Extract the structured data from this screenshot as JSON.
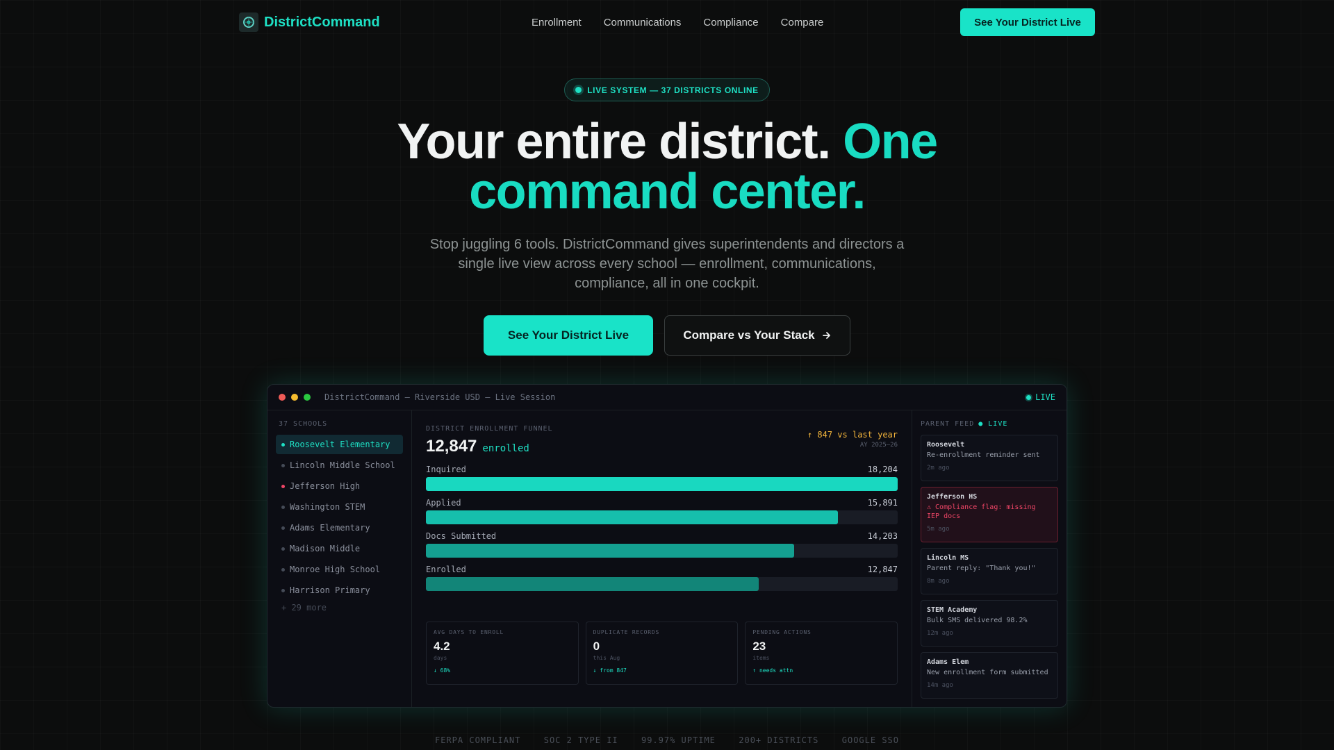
{
  "nav": {
    "brand": "DistrictCommand",
    "links": [
      "Enrollment",
      "Communications",
      "Compliance",
      "Compare"
    ],
    "cta_label": "See Your District Live"
  },
  "hero": {
    "badge": "LIVE SYSTEM — 37 DISTRICTS ONLINE",
    "headline_plain": "Your entire district.",
    "headline_accent": "One command center.",
    "subhead": "Stop juggling 6 tools. DistrictCommand gives superintendents and directors a single live view across every school — enrollment, communications, compliance, all in one cockpit.",
    "primary_cta": "See Your District Live",
    "secondary_cta": "Compare vs Your Stack"
  },
  "dashboard": {
    "window_title": "DistrictCommand — Riverside USD — Live Session",
    "live_label": "LIVE",
    "sidebar": {
      "heading": "37 SCHOOLS",
      "schools": [
        {
          "name": "Roosevelt Elementary",
          "state": "active"
        },
        {
          "name": "Lincoln Middle School",
          "state": "normal"
        },
        {
          "name": "Jefferson High",
          "state": "alert"
        },
        {
          "name": "Washington STEM",
          "state": "normal"
        },
        {
          "name": "Adams Elementary",
          "state": "normal"
        },
        {
          "name": "Madison Middle",
          "state": "normal"
        },
        {
          "name": "Monroe High School",
          "state": "normal"
        },
        {
          "name": "Harrison Primary",
          "state": "normal"
        }
      ],
      "more": "+ 29 more"
    },
    "funnel": {
      "heading": "DISTRICT ENROLLMENT FUNNEL",
      "total": "12,847",
      "total_unit": "enrolled",
      "yoy": "↑ 847 vs last year",
      "year": "AY 2025–26",
      "max": 18204,
      "stages": [
        {
          "label": "Inquired",
          "display": "18,204",
          "value": 18204,
          "color": "#19d8c0"
        },
        {
          "label": "Applied",
          "display": "15,891",
          "value": 15891,
          "color": "#16bfac"
        },
        {
          "label": "Docs Submitted",
          "display": "14,203",
          "value": 14203,
          "color": "#14a091"
        },
        {
          "label": "Enrolled",
          "display": "12,847",
          "value": 12847,
          "color": "#128578"
        }
      ]
    },
    "stats": [
      {
        "label": "AVG DAYS TO ENROLL",
        "value": "4.2",
        "sub": "days",
        "trend": "↓ 68%"
      },
      {
        "label": "DUPLICATE RECORDS",
        "value": "0",
        "sub": "this Aug",
        "trend": "↓ from 847"
      },
      {
        "label": "PENDING ACTIONS",
        "value": "23",
        "sub": "items",
        "trend": "↑ needs attn"
      }
    ],
    "feed": {
      "heading": "PARENT FEED",
      "live": "● LIVE",
      "items": [
        {
          "who": "Roosevelt",
          "msg": "Re-enrollment reminder sent",
          "ago": "2m ago",
          "warn": false
        },
        {
          "who": "Jefferson HS",
          "msg": "⚠ Compliance flag: missing IEP docs",
          "ago": "5m ago",
          "warn": true
        },
        {
          "who": "Lincoln MS",
          "msg": "Parent reply: \"Thank you!\"",
          "ago": "8m ago",
          "warn": false
        },
        {
          "who": "STEM Academy",
          "msg": "Bulk SMS delivered 98.2%",
          "ago": "12m ago",
          "warn": false
        },
        {
          "who": "Adams Elem",
          "msg": "New enrollment form submitted",
          "ago": "14m ago",
          "warn": false
        }
      ]
    }
  },
  "trust": [
    "FERPA COMPLIANT",
    "SOC 2 TYPE II",
    "99.97% UPTIME",
    "200+ DISTRICTS",
    "GOOGLE SSO"
  ],
  "colors": {
    "accent": "#19e3c8",
    "warning": "#f6b73c",
    "danger": "#ef4566",
    "background": "#0c0d0d"
  }
}
